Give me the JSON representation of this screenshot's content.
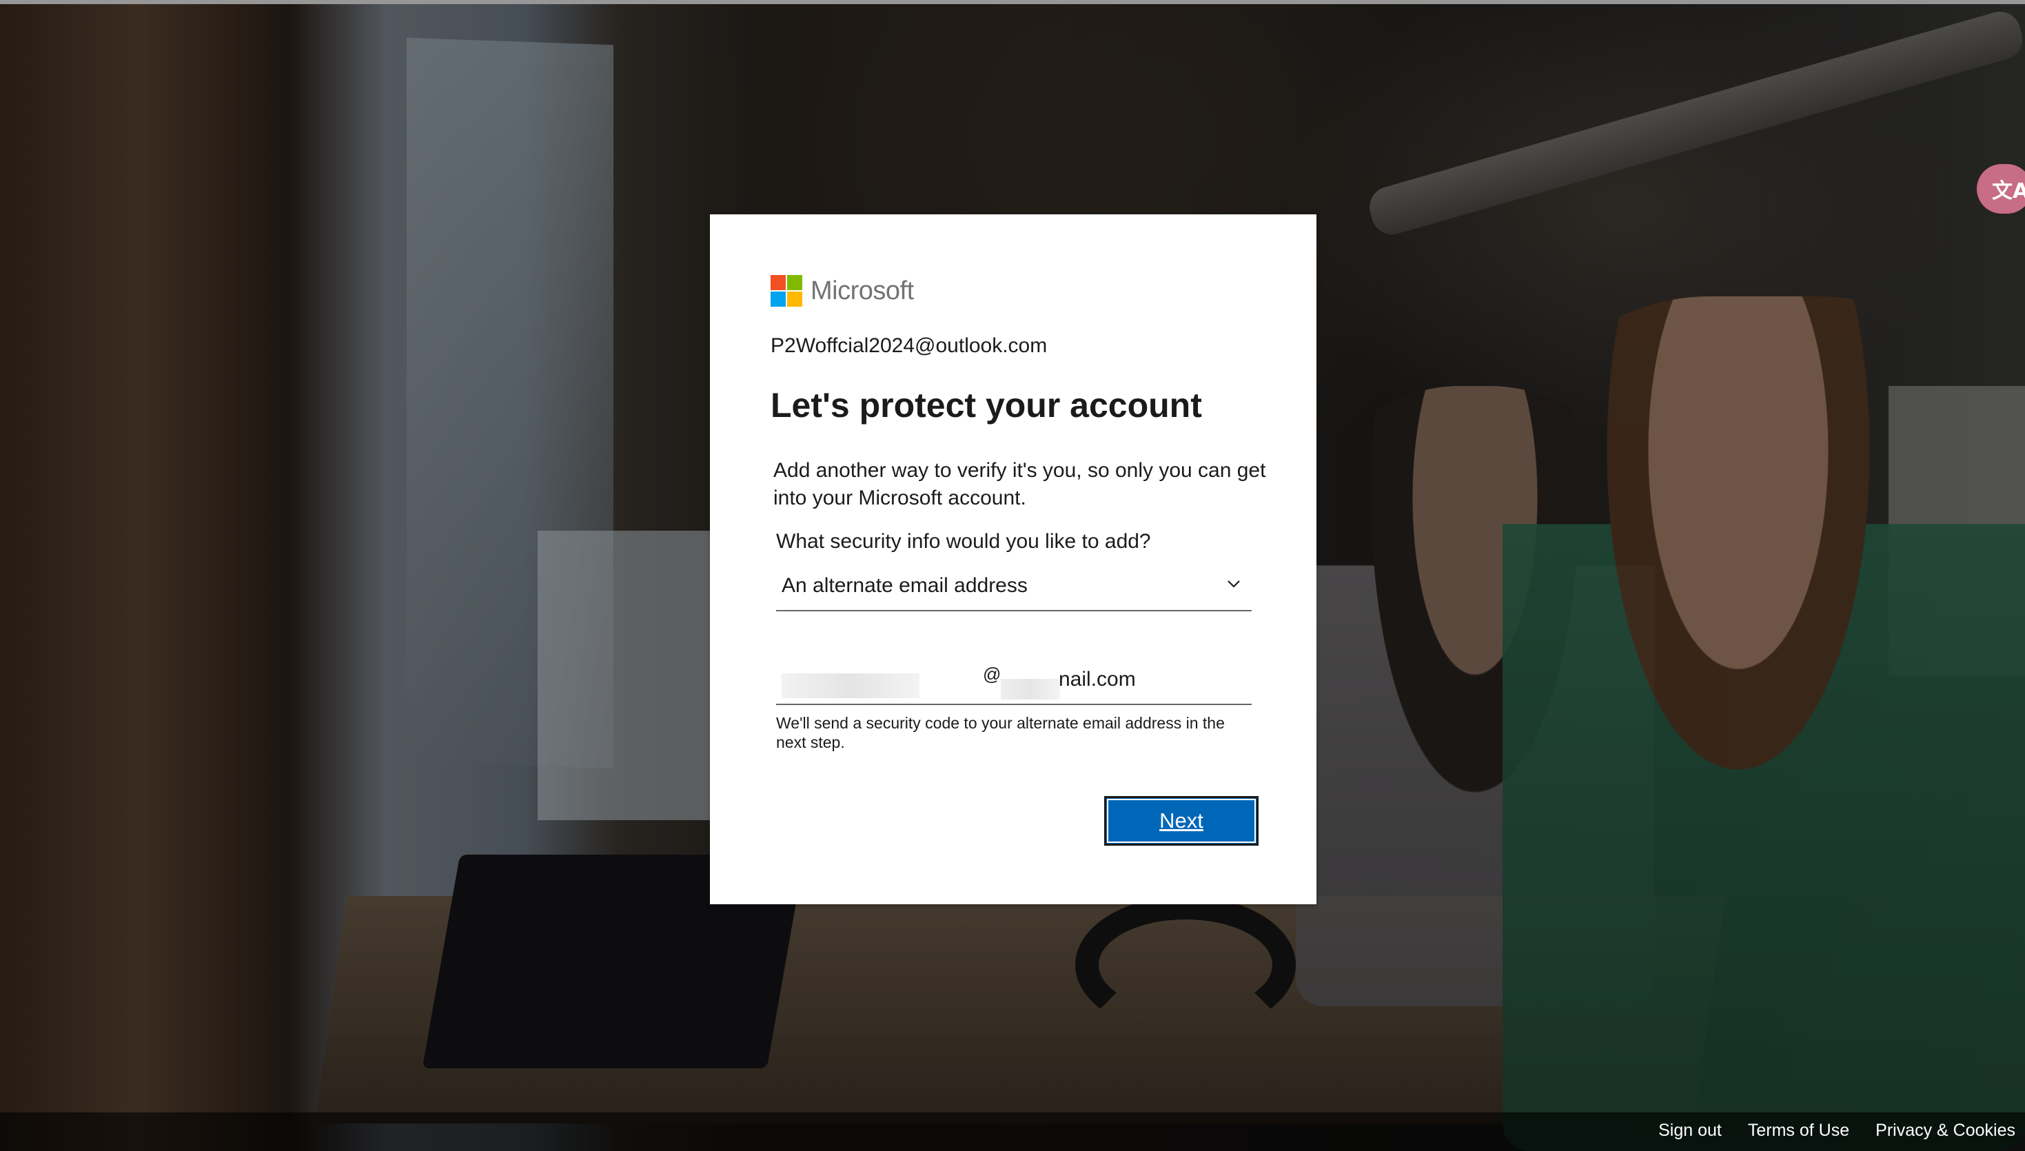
{
  "brand": {
    "name": "Microsoft",
    "colors": [
      "#f25022",
      "#7fba00",
      "#00a4ef",
      "#ffb900"
    ]
  },
  "account": {
    "email": "P2Woffcial2024@outlook.com"
  },
  "page": {
    "title": "Let's protect your account",
    "description": "Add another way to verify it's you, so only you can get into your Microsoft account.",
    "question": "What security info would you like to add?"
  },
  "security_select": {
    "selected": "An alternate email address",
    "icon": "chevron-down-icon"
  },
  "email_input": {
    "at_sign": "@",
    "domain_visible": "nail.com"
  },
  "helper_text": "We'll send a security code to your alternate email address in the next step.",
  "next_button": {
    "label": "Next",
    "color": "#0067b8"
  },
  "translate_badge": {
    "icon": "translate-icon",
    "glyph": "文A",
    "color": "#c86d86"
  },
  "footer": {
    "links": [
      "Sign out",
      "Terms of Use",
      "Privacy & Cookies"
    ]
  }
}
